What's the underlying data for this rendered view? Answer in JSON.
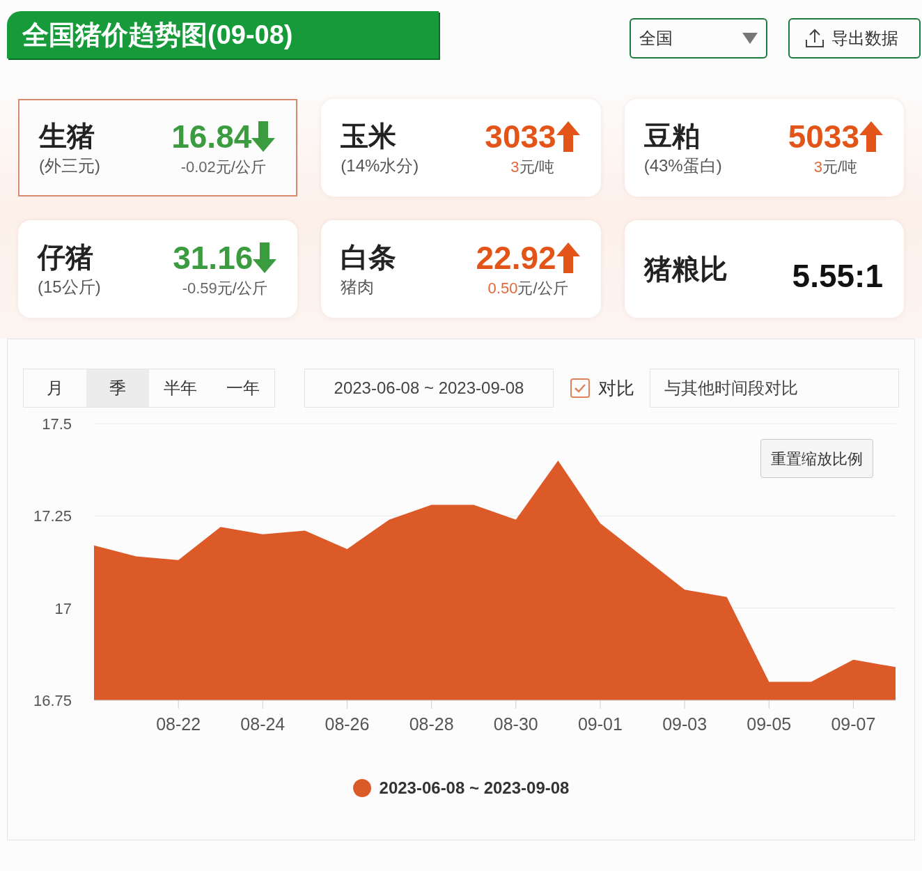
{
  "header": {
    "title": "全国猪价趋势图(09-08)",
    "region_select": "全国",
    "export_button": "导出数据"
  },
  "cards": [
    {
      "label": "生猪",
      "sub": "(外三元)",
      "value": "16.84",
      "kind": "down",
      "change_value": "-0.02",
      "change_unit": "元/公斤",
      "selected": true
    },
    {
      "label": "玉米",
      "sub": "(14%水分)",
      "value": "3033",
      "kind": "up",
      "change_value": "3",
      "change_unit": "元/吨",
      "selected": false
    },
    {
      "label": "豆粕",
      "sub": "(43%蛋白)",
      "value": "5033",
      "kind": "up",
      "change_value": "3",
      "change_unit": "元/吨",
      "selected": false
    },
    {
      "label": "仔猪",
      "sub": "(15公斤)",
      "value": "31.16",
      "kind": "down",
      "change_value": "-0.59",
      "change_unit": "元/公斤",
      "selected": false
    },
    {
      "label": "白条",
      "sub": "猪肉",
      "value": "22.92",
      "kind": "up",
      "change_value": "0.50",
      "change_unit": "元/公斤",
      "selected": false
    },
    {
      "label": "猪粮比",
      "value": "5.55:1",
      "kind": "plain",
      "selected": false
    }
  ],
  "periods": [
    {
      "label": "月",
      "selected": false
    },
    {
      "label": "季",
      "selected": true
    },
    {
      "label": "半年",
      "selected": false
    },
    {
      "label": "一年",
      "selected": false
    }
  ],
  "date_range": "2023-06-08 ~ 2023-09-08",
  "compare": {
    "label": "对比",
    "checked": true
  },
  "compare_field": {
    "placeholder": "与其他时间段对比"
  },
  "reset_zoom_button": "重置缩放比例",
  "chart_data": {
    "type": "area",
    "categories": [
      null,
      null,
      "08-22",
      null,
      "08-24",
      null,
      "08-26",
      null,
      "08-28",
      null,
      "08-30",
      null,
      "09-01",
      null,
      "09-03",
      null,
      "09-05",
      null,
      "09-07",
      null
    ],
    "yticks": [
      16.75,
      17,
      17.25,
      17.5
    ],
    "ylim": [
      16.75,
      17.5
    ],
    "series": [
      {
        "name": "2023-06-08 ~ 2023-09-08",
        "color": "#dc5a28",
        "values": [
          17.17,
          17.14,
          17.13,
          17.22,
          17.2,
          17.21,
          17.16,
          17.24,
          17.28,
          17.28,
          17.24,
          17.4,
          17.23,
          17.14,
          17.05,
          17.03,
          16.8,
          16.8,
          16.86,
          16.84
        ]
      }
    ]
  }
}
